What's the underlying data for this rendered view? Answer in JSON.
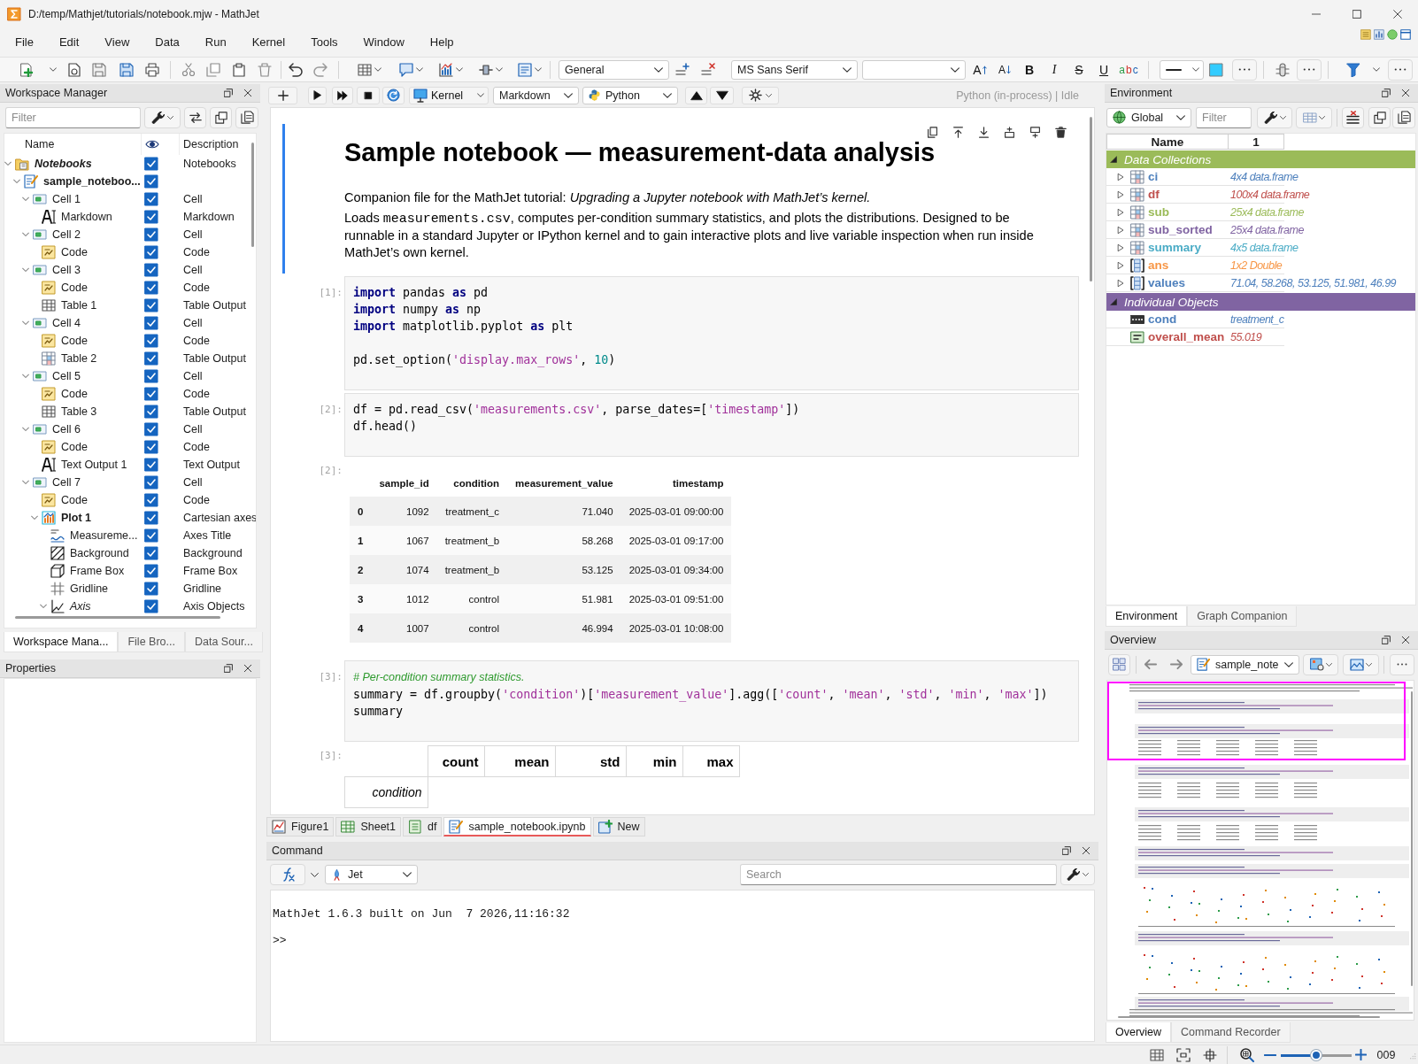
{
  "window": {
    "title": "D:/temp/Mathjet/tutorials/notebook.mjw - MathJet"
  },
  "menu": [
    "File",
    "Edit",
    "View",
    "Data",
    "Run",
    "Kernel",
    "Tools",
    "Window",
    "Help"
  ],
  "toolbar": {
    "style": "General",
    "font": "MS Sans Serif",
    "format_buttons": [
      {
        "label": "A",
        "kind": "grow"
      },
      {
        "label": "A",
        "kind": "shrink"
      },
      {
        "label": "B",
        "kind": "bold"
      },
      {
        "label": "I",
        "kind": "italic"
      },
      {
        "label": "S",
        "kind": "strike"
      },
      {
        "label": "U",
        "kind": "underline"
      },
      {
        "label": "abc",
        "kind": "color"
      }
    ]
  },
  "workspace": {
    "title": "Workspace Manager",
    "filter": {
      "placeholder": "Filter"
    },
    "columns": [
      "Name",
      "Description"
    ],
    "tree": [
      {
        "name": "Notebooks",
        "kind": "folder",
        "checked": true,
        "description": "Notebooks",
        "expanded": true,
        "children": [
          {
            "name": "sample_noteboo...",
            "kind": "notebook",
            "checked": true,
            "expanded": true,
            "children": [
              {
                "name": "Cell 1",
                "kind": "cell",
                "checked": true,
                "description": "Cell",
                "expanded": true,
                "children": [
                  {
                    "name": "Markdown",
                    "kind": "markdown",
                    "checked": true,
                    "description": "Markdown"
                  }
                ]
              },
              {
                "name": "Cell 2",
                "kind": "cell",
                "checked": true,
                "description": "Cell",
                "expanded": true,
                "children": [
                  {
                    "name": "Code",
                    "kind": "code",
                    "checked": true,
                    "description": "Code"
                  }
                ]
              },
              {
                "name": "Cell 3",
                "kind": "cell",
                "checked": true,
                "description": "Cell",
                "expanded": true,
                "children": [
                  {
                    "name": "Code",
                    "kind": "code",
                    "checked": true,
                    "description": "Code"
                  },
                  {
                    "name": "Table 1",
                    "kind": "table",
                    "checked": true,
                    "description": "Table Output"
                  }
                ]
              },
              {
                "name": "Cell 4",
                "kind": "cell",
                "checked": true,
                "description": "Cell",
                "expanded": true,
                "children": [
                  {
                    "name": "Code",
                    "kind": "code",
                    "checked": true,
                    "description": "Code"
                  },
                  {
                    "name": "Table 2",
                    "kind": "dataframe",
                    "checked": true,
                    "description": "Table Output"
                  }
                ]
              },
              {
                "name": "Cell 5",
                "kind": "cell",
                "checked": true,
                "description": "Cell",
                "expanded": true,
                "children": [
                  {
                    "name": "Code",
                    "kind": "code",
                    "checked": true,
                    "description": "Code"
                  },
                  {
                    "name": "Table 3",
                    "kind": "table",
                    "checked": true,
                    "description": "Table Output"
                  }
                ]
              },
              {
                "name": "Cell 6",
                "kind": "cell",
                "checked": true,
                "description": "Cell",
                "expanded": true,
                "children": [
                  {
                    "name": "Code",
                    "kind": "code",
                    "checked": true,
                    "description": "Code"
                  },
                  {
                    "name": "Text Output 1",
                    "kind": "text",
                    "checked": true,
                    "description": "Text Output"
                  }
                ]
              },
              {
                "name": "Cell 7",
                "kind": "cell",
                "checked": true,
                "description": "Cell",
                "expanded": true,
                "children": [
                  {
                    "name": "Code",
                    "kind": "code",
                    "checked": true,
                    "description": "Code"
                  },
                  {
                    "name": "Plot 1",
                    "kind": "plot",
                    "checked": true,
                    "description": "Cartesian axes",
                    "expanded": true,
                    "children": [
                      {
                        "name": "Measureme...",
                        "kind": "title",
                        "checked": true,
                        "description": "Axes Title"
                      },
                      {
                        "name": "Background",
                        "kind": "background",
                        "checked": true,
                        "description": "Background"
                      },
                      {
                        "name": "Frame Box",
                        "kind": "box",
                        "checked": true,
                        "description": "Frame Box"
                      },
                      {
                        "name": "Gridline",
                        "kind": "gridline",
                        "checked": true,
                        "description": "Gridline"
                      },
                      {
                        "name": "Axis",
                        "kind": "axis",
                        "checked": true,
                        "description": "Axis Objects",
                        "expanded": true
                      }
                    ]
                  }
                ]
              }
            ]
          }
        ]
      }
    ],
    "tabs": [
      {
        "label": "Workspace Mana...",
        "selected": true
      },
      {
        "label": "File Bro...",
        "selected": false
      },
      {
        "label": "Data Sour...",
        "selected": false
      }
    ]
  },
  "properties": {
    "title": "Properties"
  },
  "notebook": {
    "toolbar": {
      "kernel": "Kernel",
      "cell_type": "Markdown",
      "language": "Python",
      "status": "Python (in-process) | Idle"
    },
    "cells": [
      {
        "kind": "markdown",
        "selected": true,
        "heading": "Sample notebook — measurement-data analysis",
        "paragraphs": [
          [
            {
              "kind": "text",
              "text": "Companion file for the MathJet tutorial: *Upgrading a Jupyter notebook with MathJet’s kernel.*"
            }
          ],
          [
            {
              "kind": "text",
              "text": "Loads "
            },
            {
              "kind": "code",
              "text": "measurements.csv"
            },
            {
              "kind": "text",
              "text": ", computes per-condition summary statistics, and plots the distributions. Designed to be runnable in a standard Jupyter or IPython kernel and to gain interactive plots and live variable inspection when run inside MathJet’s own kernel."
            }
          ]
        ]
      },
      {
        "kind": "code",
        "selected": false,
        "prompt": "[1]:",
        "blocks": [
          [
            [
              {
                "kind": "keyword",
                "text": "import"
              },
              {
                "kind": "plain",
                "text": " pandas "
              },
              {
                "kind": "keyword",
                "text": "as"
              },
              {
                "kind": "plain",
                "text": " pd"
              }
            ],
            [
              {
                "kind": "keyword",
                "text": "import"
              },
              {
                "kind": "plain",
                "text": " numpy "
              },
              {
                "kind": "keyword",
                "text": "as"
              },
              {
                "kind": "plain",
                "text": " np"
              }
            ],
            [
              {
                "kind": "keyword",
                "text": "import"
              },
              {
                "kind": "plain",
                "text": " matplotlib.pyplot "
              },
              {
                "kind": "keyword",
                "text": "as"
              },
              {
                "kind": "plain",
                "text": " plt"
              }
            ]
          ],
          [
            [
              {
                "kind": "plain",
                "text": "pd.set_option("
              },
              {
                "kind": "string",
                "text": "'display.max_rows'"
              },
              {
                "kind": "plain",
                "text": ", "
              },
              {
                "kind": "number",
                "text": "10"
              },
              {
                "kind": "plain",
                "text": ")"
              }
            ]
          ]
        ]
      },
      {
        "kind": "code",
        "selected": false,
        "prompt": "[2]:",
        "blocks": [
          [
            [
              {
                "kind": "plain",
                "text": "df = pd.read_csv("
              },
              {
                "kind": "string",
                "text": "'measurements.csv'"
              },
              {
                "kind": "plain",
                "text": ", parse_dates=["
              },
              {
                "kind": "string",
                "text": "'timestamp'"
              },
              {
                "kind": "plain",
                "text": "])"
              }
            ],
            [
              {
                "kind": "plain",
                "text": "df.head()"
              }
            ]
          ]
        ]
      },
      {
        "kind": "table",
        "selected": false,
        "prompt": "[2]:",
        "columns": [
          "sample_id",
          "condition",
          "measurement_value",
          "timestamp"
        ],
        "rows": [
          {
            "index": "0",
            "cells": [
              "1092",
              "treatment_c",
              "71.040",
              "2025-03-01 09:00:00"
            ]
          },
          {
            "index": "1",
            "cells": [
              "1067",
              "treatment_b",
              "58.268",
              "2025-03-01 09:17:00"
            ]
          },
          {
            "index": "2",
            "cells": [
              "1074",
              "treatment_b",
              "53.125",
              "2025-03-01 09:34:00"
            ]
          },
          {
            "index": "3",
            "cells": [
              "1012",
              "control",
              "51.981",
              "2025-03-01 09:51:00"
            ]
          },
          {
            "index": "4",
            "cells": [
              "1007",
              "control",
              "46.994",
              "2025-03-01 10:08:00"
            ]
          }
        ]
      },
      {
        "kind": "code",
        "selected": false,
        "prompt": "[3]:",
        "blocks": [
          [
            [
              {
                "kind": "comment",
                "text": "# Per-condition summary statistics."
              }
            ],
            [
              {
                "kind": "plain",
                "text": "summary = df.groupby("
              },
              {
                "kind": "string",
                "text": "'condition'"
              },
              {
                "kind": "plain",
                "text": ")["
              },
              {
                "kind": "string",
                "text": "'measurement_value'"
              },
              {
                "kind": "plain",
                "text": "].agg(["
              },
              {
                "kind": "string",
                "text": "'count'"
              },
              {
                "kind": "plain",
                "text": ", "
              },
              {
                "kind": "string",
                "text": "'mean'"
              },
              {
                "kind": "plain",
                "text": ", "
              },
              {
                "kind": "string",
                "text": "'std'"
              },
              {
                "kind": "plain",
                "text": ", "
              },
              {
                "kind": "string",
                "text": "'min'"
              },
              {
                "kind": "plain",
                "text": ", "
              },
              {
                "kind": "string",
                "text": "'max'"
              },
              {
                "kind": "plain",
                "text": "])"
              }
            ],
            [
              {
                "kind": "plain",
                "text": "summary"
              }
            ]
          ]
        ]
      },
      {
        "kind": "summary",
        "selected": false,
        "prompt": "[3]:",
        "columns": [
          "count",
          "mean",
          "std",
          "min",
          "max"
        ],
        "index_name": "condition"
      }
    ]
  },
  "document_tabs": [
    {
      "label": "Figure1",
      "kind": "figure",
      "selected": false
    },
    {
      "label": "Sheet1",
      "kind": "sheet",
      "selected": false
    },
    {
      "label": "df",
      "kind": "dataframe",
      "selected": false
    },
    {
      "label": "sample_notebook.ipynb",
      "kind": "notebook",
      "selected": true
    },
    {
      "label": "New",
      "kind": "new",
      "selected": false
    }
  ],
  "command": {
    "title": "Command",
    "engine": "Jet",
    "search": {
      "placeholder": "Search"
    },
    "console": [
      "MathJet 1.6.3 built on Jun  7 2026,11:16:32"
    ],
    "prompt": ">>"
  },
  "environment": {
    "title": "Environment",
    "scope": "Global",
    "filter": {
      "placeholder": "Filter"
    },
    "columns": [
      "Name",
      "1"
    ],
    "groups": [
      {
        "label": "Data Collections",
        "color": "#9bbb59",
        "expanded": true,
        "items": [
          {
            "name": "ci",
            "kind": "dataframe",
            "value": "4x4 data.frame",
            "color": "#4f81bd",
            "expanded": false
          },
          {
            "name": "df",
            "kind": "dataframe",
            "value": "100x4 data.frame",
            "color": "#c0504d",
            "expanded": false
          },
          {
            "name": "sub",
            "kind": "dataframe",
            "value": "25x4 data.frame",
            "color": "#9bbb59",
            "expanded": false
          },
          {
            "name": "sub_sorted",
            "kind": "dataframe",
            "value": "25x4 data.frame",
            "color": "#8064a2",
            "expanded": false
          },
          {
            "name": "summary",
            "kind": "dataframe",
            "value": "4x5 data.frame",
            "color": "#4bacc6",
            "expanded": false
          },
          {
            "name": "ans",
            "kind": "array",
            "value": "1x2 Double",
            "color": "#f79646",
            "expanded": false
          },
          {
            "name": "values",
            "kind": "array",
            "value": "71.04, 58.268, 53.125, 51.981, 46.99",
            "color": "#4f81bd",
            "expanded": false
          }
        ]
      },
      {
        "label": "Individual Objects",
        "color": "#8064a2",
        "expanded": true,
        "items": [
          {
            "name": "cond",
            "kind": "string",
            "value": "treatment_c",
            "color": "#4f81bd"
          },
          {
            "name": "overall_mean",
            "kind": "number",
            "value": "55.019",
            "color": "#c0504d"
          }
        ]
      }
    ],
    "tabs": [
      {
        "label": "Environment",
        "selected": true
      },
      {
        "label": "Graph Companion",
        "selected": false
      }
    ]
  },
  "overview": {
    "title": "Overview",
    "document": "sample_note",
    "tabs": [
      {
        "label": "Overview",
        "selected": true
      },
      {
        "label": "Command Recorder",
        "selected": false
      }
    ]
  },
  "status_bar": {
    "zoom": {
      "level": 0.5,
      "reading": "009"
    }
  }
}
